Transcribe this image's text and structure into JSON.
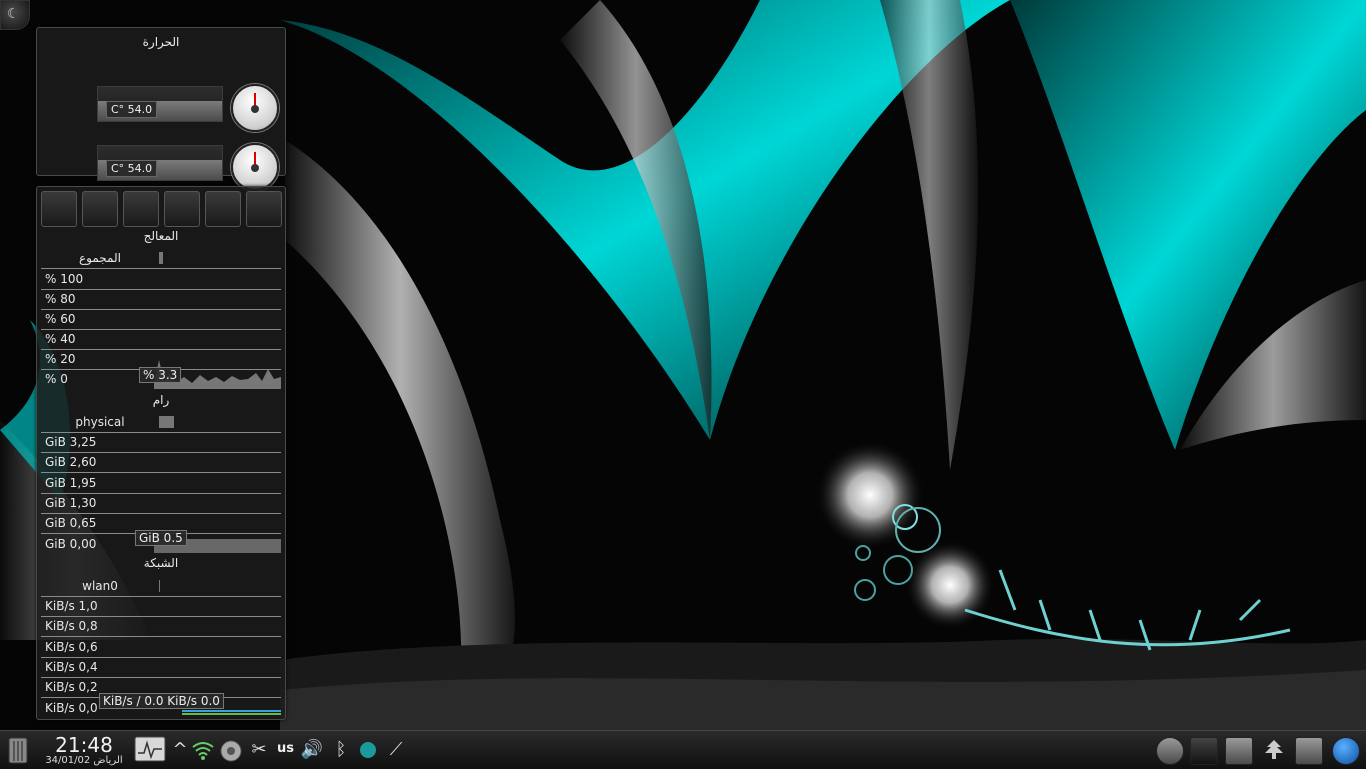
{
  "temperature": {
    "title": "الحرارة",
    "sensors": [
      {
        "value": "C° 54.0"
      },
      {
        "value": "C° 54.0"
      }
    ]
  },
  "monitor": {
    "tab_icons": [
      "signal-bars-icon",
      "cpu-chip-icon",
      "network-computers-icon",
      "lock-drive-icon",
      "hard-disk-icon",
      "removable-drive-icon"
    ],
    "cpu": {
      "title": "المعالج",
      "legend": "المجموع",
      "rows": [
        "% 100",
        "% 80",
        "% 60",
        "% 40",
        "% 20",
        "% 0"
      ],
      "current": "% 3.3"
    },
    "ram": {
      "title": "رام",
      "legend": "physical",
      "rows": [
        "GiB 3,25",
        "GiB 2,60",
        "GiB 1,95",
        "GiB 1,30",
        "GiB 0,65",
        "GiB 0,00"
      ],
      "current": "GiB 0.5"
    },
    "network": {
      "title": "الشبكة",
      "legend": "wlan0",
      "rows": [
        "KiB/s 1,0",
        "KiB/s 0,8",
        "KiB/s 0,6",
        "KiB/s 0,4",
        "KiB/s 0,2",
        "KiB/s 0,0"
      ],
      "current": "KiB/s / 0.0 KiB/s 0.0"
    }
  },
  "panel": {
    "clock_time": "21:48",
    "clock_date": "34/01/02 الرياض",
    "keyboard_layout": "us",
    "tray_icons": [
      "expand-arrow-icon",
      "wifi-icon",
      "network-settings-icon",
      "scissors-icon",
      "volume-icon",
      "bluetooth-icon",
      "status-dot-icon",
      "color-picker-icon"
    ],
    "launchers": [
      "software-center-icon",
      "terminal-icon",
      "system-monitor-icon",
      "pc-icon",
      "file-manager-icon",
      "kde-menu-icon"
    ]
  },
  "colors": {
    "accent": "#00c8c8",
    "panel": "#1a1a1a"
  }
}
